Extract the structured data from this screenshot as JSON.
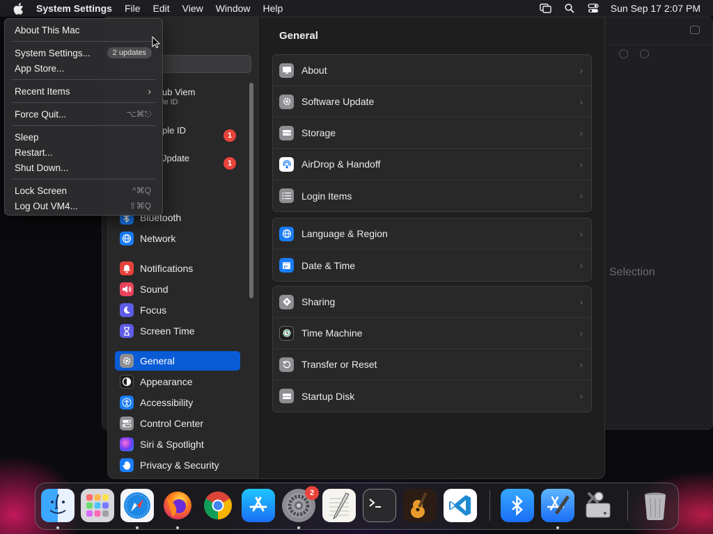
{
  "menubar": {
    "app_name": "System Settings",
    "items": [
      "File",
      "Edit",
      "View",
      "Window",
      "Help"
    ],
    "clock": "Sun Sep 17  2:07 PM",
    "status_icons": [
      "screen-mirroring-icon",
      "spotlight-search-icon",
      "control-center-icon"
    ]
  },
  "apple_menu": {
    "about": "About This Mac",
    "system_settings": "System Settings...",
    "updates_badge": "2 updates",
    "app_store": "App Store...",
    "recent_items": "Recent Items",
    "force_quit": "Force Quit...",
    "force_quit_shortcut": "⌥⌘⎋",
    "sleep": "Sleep",
    "restart": "Restart...",
    "shut_down": "Shut Down...",
    "lock_screen": "Lock Screen",
    "lock_shortcut": "^⌘Q",
    "log_out": "Log Out VM4...",
    "log_out_shortcut": "⇧⌘Q"
  },
  "sidebar": {
    "account_name": "ub Viem",
    "account_sub": "le ID",
    "apple_id_partial": "ple ID",
    "apple_id_badge": "1",
    "update_partial": "Jpdate",
    "update_badge": "1",
    "items": [
      {
        "label": "Bluetooth",
        "icon": "bluetooth-icon",
        "color": "#1a7cf5"
      },
      {
        "label": "Network",
        "icon": "globe-icon",
        "color": "#1a7cf5"
      },
      {
        "label": "Notifications",
        "icon": "bell-icon",
        "color": "#e8433b"
      },
      {
        "label": "Sound",
        "icon": "speaker-icon",
        "color": "#e8435a"
      },
      {
        "label": "Focus",
        "icon": "moon-icon",
        "color": "#5e5ce6"
      },
      {
        "label": "Screen Time",
        "icon": "hourglass-icon",
        "color": "#5e5ce6"
      },
      {
        "label": "General",
        "icon": "gear-icon",
        "color": "#8e8e93"
      },
      {
        "label": "Appearance",
        "icon": "appearance-icon",
        "color": "#1c1c1e"
      },
      {
        "label": "Accessibility",
        "icon": "accessibility-icon",
        "color": "#1a7cf5"
      },
      {
        "label": "Control Center",
        "icon": "switches-icon",
        "color": "#8e8e93"
      },
      {
        "label": "Siri & Spotlight",
        "icon": "siri-icon",
        "color": "#b04ad8"
      },
      {
        "label": "Privacy & Security",
        "icon": "hand-icon",
        "color": "#1a7cf5"
      }
    ]
  },
  "content": {
    "title": "General",
    "groups": [
      [
        {
          "label": "About",
          "icon": "display-icon"
        },
        {
          "label": "Software Update",
          "icon": "gear-badge-icon"
        },
        {
          "label": "Storage",
          "icon": "drive-icon"
        },
        {
          "label": "AirDrop & Handoff",
          "icon": "airdrop-icon"
        },
        {
          "label": "Login Items",
          "icon": "list-icon"
        }
      ],
      [
        {
          "label": "Language & Region",
          "icon": "globe-icon"
        },
        {
          "label": "Date & Time",
          "icon": "calendar-icon"
        }
      ],
      [
        {
          "label": "Sharing",
          "icon": "sharing-icon"
        },
        {
          "label": "Time Machine",
          "icon": "time-machine-icon"
        },
        {
          "label": "Transfer or Reset",
          "icon": "reset-icon"
        },
        {
          "label": "Startup Disk",
          "icon": "disk-icon"
        }
      ]
    ]
  },
  "background_window": {
    "partial_text": "Selection"
  },
  "dock": {
    "apps": [
      {
        "name": "finder-icon"
      },
      {
        "name": "launchpad-icon"
      },
      {
        "name": "safari-icon"
      },
      {
        "name": "firefox-icon"
      },
      {
        "name": "chrome-icon"
      },
      {
        "name": "app-store-icon"
      },
      {
        "name": "system-settings-icon",
        "badge": "2"
      },
      {
        "name": "textedit-icon"
      },
      {
        "name": "terminal-icon"
      },
      {
        "name": "garageband-icon"
      },
      {
        "name": "vscode-icon"
      },
      {
        "name": "bluetooth-app-icon"
      },
      {
        "name": "xcode-icon"
      },
      {
        "name": "disk-utility-icon"
      },
      {
        "name": "trash-icon"
      }
    ]
  }
}
